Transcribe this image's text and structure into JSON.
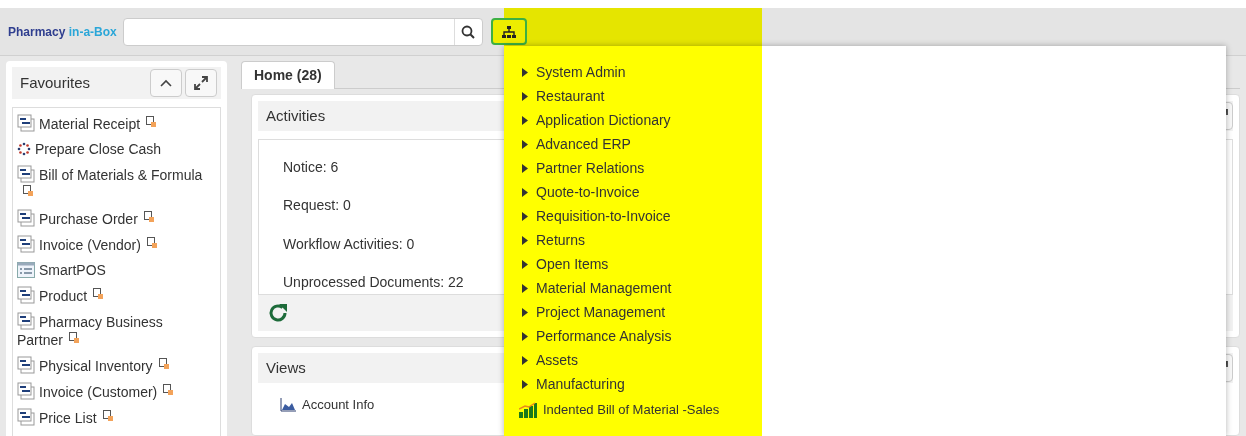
{
  "brand": {
    "name": "Pharmacy",
    "suffix": "in-a-Box"
  },
  "favourites": {
    "title": "Favourites",
    "items": [
      {
        "label": "Material Receipt",
        "kind": "window",
        "new_window": true
      },
      {
        "label": "Prepare Close Cash",
        "kind": "process",
        "new_window": false
      },
      {
        "label": "Bill of Materials & Formula",
        "kind": "window",
        "new_window": true
      },
      {
        "label": "Purchase Order",
        "kind": "window",
        "new_window": true
      },
      {
        "label": "Invoice (Vendor)",
        "kind": "window",
        "new_window": true
      },
      {
        "label": "SmartPOS",
        "kind": "form",
        "new_window": false
      },
      {
        "label": "Product",
        "kind": "window",
        "new_window": true
      },
      {
        "label": "Pharmacy Business Partner",
        "kind": "window",
        "new_window": true
      },
      {
        "label": "Physical Inventory",
        "kind": "window",
        "new_window": true
      },
      {
        "label": "Invoice (Customer)",
        "kind": "window",
        "new_window": true
      },
      {
        "label": "Price List",
        "kind": "window",
        "new_window": true
      }
    ]
  },
  "tabs": [
    {
      "label": "Home (28)",
      "selected": true
    }
  ],
  "activities": {
    "title": "Activities",
    "items": [
      "Notice: 6",
      "Request: 0",
      "Workflow Activities: 0",
      "Unprocessed Documents: 22"
    ]
  },
  "views": {
    "title": "Views",
    "items": [
      "Account Info"
    ]
  },
  "menu": {
    "items": [
      {
        "label": "System Admin",
        "kind": "folder"
      },
      {
        "label": "Restaurant",
        "kind": "folder"
      },
      {
        "label": "Application Dictionary",
        "kind": "folder"
      },
      {
        "label": "Advanced ERP",
        "kind": "folder"
      },
      {
        "label": "Partner Relations",
        "kind": "folder"
      },
      {
        "label": "Quote-to-Invoice",
        "kind": "folder"
      },
      {
        "label": "Requisition-to-Invoice",
        "kind": "folder"
      },
      {
        "label": "Returns",
        "kind": "folder"
      },
      {
        "label": "Open Items",
        "kind": "folder"
      },
      {
        "label": "Material Management",
        "kind": "folder"
      },
      {
        "label": "Project Management",
        "kind": "folder"
      },
      {
        "label": "Performance Analysis",
        "kind": "folder"
      },
      {
        "label": "Assets",
        "kind": "folder"
      },
      {
        "label": "Manufacturing",
        "kind": "folder"
      },
      {
        "label": "Indented Bill of Material -Sales",
        "kind": "report"
      }
    ]
  }
}
